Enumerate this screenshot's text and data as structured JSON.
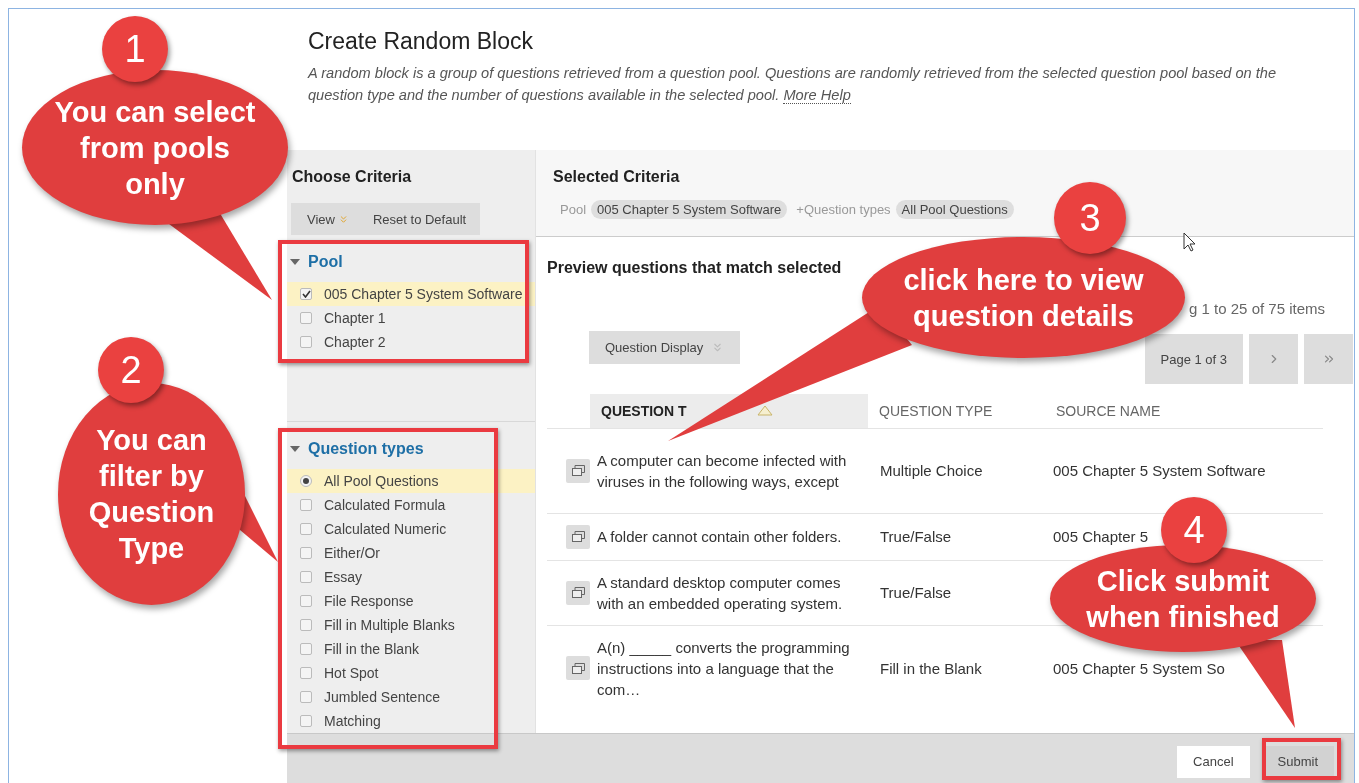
{
  "page": {
    "title": "Create Random Block",
    "description": "A random block is a group of questions retrieved from a question pool. Questions are randomly retrieved from the selected question pool based on the question type and the number of questions available in the selected pool.",
    "help_link": "More Help"
  },
  "choose_criteria": {
    "title": "Choose Criteria",
    "buttons": [
      {
        "label": "View",
        "kind": "menu"
      },
      {
        "label": "Reset to Default",
        "kind": "plain"
      }
    ],
    "pool": {
      "label": "Pool",
      "expanded": true,
      "items": [
        {
          "label": "005 Chapter 5 System Software",
          "checked": true
        },
        {
          "label": "Chapter 1",
          "checked": false
        },
        {
          "label": "Chapter 2",
          "checked": false
        }
      ]
    },
    "question_types": {
      "label": "Question types",
      "expanded": true,
      "items": [
        {
          "label": "All Pool Questions",
          "kind": "radio",
          "checked": true
        },
        {
          "label": "Calculated Formula",
          "kind": "checkbox",
          "checked": false
        },
        {
          "label": "Calculated Numeric",
          "kind": "checkbox",
          "checked": false
        },
        {
          "label": "Either/Or",
          "kind": "checkbox",
          "checked": false
        },
        {
          "label": "Essay",
          "kind": "checkbox",
          "checked": false
        },
        {
          "label": "File Response",
          "kind": "checkbox",
          "checked": false
        },
        {
          "label": "Fill in Multiple Blanks",
          "kind": "checkbox",
          "checked": false
        },
        {
          "label": "Fill in the Blank",
          "kind": "checkbox",
          "checked": false
        },
        {
          "label": "Hot Spot",
          "kind": "checkbox",
          "checked": false
        },
        {
          "label": "Jumbled Sentence",
          "kind": "checkbox",
          "checked": false
        },
        {
          "label": "Matching",
          "kind": "checkbox",
          "checked": false
        }
      ]
    }
  },
  "selected_criteria": {
    "title": "Selected Criteria",
    "filters": [
      {
        "label": "Pool",
        "value": "005 Chapter 5 System Software"
      },
      {
        "prefix": "+",
        "label": "Question types",
        "value": "All Pool Questions"
      }
    ]
  },
  "preview": {
    "title": "Preview questions that match selected",
    "count": "g 1 to 25 of 75 items",
    "display_button": "Question Display",
    "page_label": "Page 1 of 3"
  },
  "table": {
    "columns": [
      {
        "label": "QUESTION T",
        "sorted": true
      },
      {
        "label": "QUESTION TYPE",
        "sorted": false
      },
      {
        "label": "SOURCE NAME",
        "sorted": false
      }
    ],
    "rows": [
      {
        "text": "A computer can become infected with viruses in the following ways, except",
        "type": "Multiple Choice",
        "source": "005 Chapter 5 System Software"
      },
      {
        "text": "A folder cannot contain other folders.",
        "type": "True/False",
        "source": "005 Chapter 5"
      },
      {
        "text": "A standard desktop computer comes with an embedded operating system.",
        "type": "True/False"
      },
      {
        "text": "A(n) _____ converts the programming instructions into a language that the com…",
        "type": "Fill in the Blank",
        "source": "005 Chapter 5 System So"
      }
    ]
  },
  "footer": {
    "buttons": [
      {
        "label": "Cancel",
        "kind": "secondary"
      },
      {
        "label": "Submit",
        "kind": "primary"
      }
    ]
  },
  "annotations": [
    {
      "number": "1",
      "text": "You can select\nfrom pools\nonly"
    },
    {
      "number": "2",
      "text": "You can\nfilter by\nQuestion\nType"
    },
    {
      "number": "3",
      "text": "click here to view\nquestion details"
    },
    {
      "number": "4",
      "text": "Click submit\nwhen finished"
    }
  ]
}
